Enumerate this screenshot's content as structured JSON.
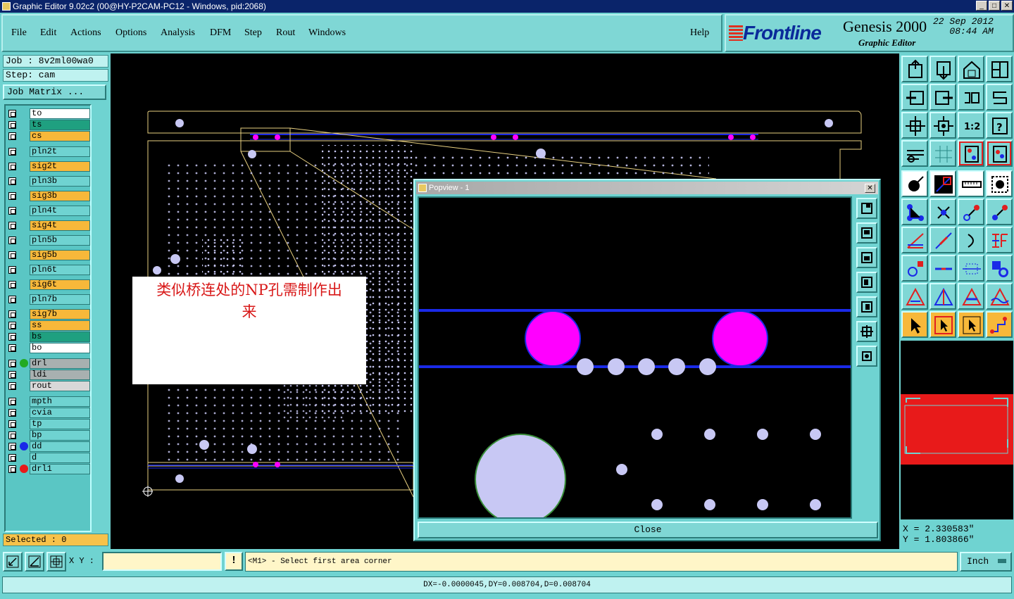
{
  "window": {
    "title": "Graphic Editor 9.02c2 (00@HY-P2CAM-PC12 - Windows, pid:2068)",
    "min": "_",
    "max": "□",
    "close": "✕"
  },
  "menu": [
    "File",
    "Edit",
    "Actions",
    "Options",
    "Analysis",
    "DFM",
    "Step",
    "Rout",
    "Windows"
  ],
  "help": "Help",
  "brand": {
    "logo": "Frontline",
    "product": "Genesis 2000",
    "subtitle": "Graphic Editor",
    "date": "22 Sep 2012",
    "time": "08:44 AM"
  },
  "job": {
    "job": "Job : 8v2ml00wa0",
    "step": "Step: cam",
    "matrix": "Job Matrix ..."
  },
  "layers": [
    {
      "name": "to",
      "color": "#ffffff",
      "dot": ""
    },
    {
      "name": "ts",
      "color": "#1fa080",
      "dot": ""
    },
    {
      "name": "cs",
      "color": "#f7b83a",
      "dot": ""
    },
    {
      "name": "pln2t",
      "color": "#6fd3d1",
      "dot": ""
    },
    {
      "name": "sig2t",
      "color": "#f7b83a",
      "dot": ""
    },
    {
      "name": "pln3b",
      "color": "#6fd3d1",
      "dot": ""
    },
    {
      "name": "sig3b",
      "color": "#f7b83a",
      "dot": ""
    },
    {
      "name": "pln4t",
      "color": "#6fd3d1",
      "dot": ""
    },
    {
      "name": "sig4t",
      "color": "#f7b83a",
      "dot": ""
    },
    {
      "name": "pln5b",
      "color": "#6fd3d1",
      "dot": ""
    },
    {
      "name": "sig5b",
      "color": "#f7b83a",
      "dot": ""
    },
    {
      "name": "pln6t",
      "color": "#6fd3d1",
      "dot": ""
    },
    {
      "name": "sig6t",
      "color": "#f7b83a",
      "dot": ""
    },
    {
      "name": "pln7b",
      "color": "#6fd3d1",
      "dot": ""
    },
    {
      "name": "sig7b",
      "color": "#f7b83a",
      "dot": ""
    },
    {
      "name": "ss",
      "color": "#f7b83a",
      "dot": ""
    },
    {
      "name": "bs",
      "color": "#1fa080",
      "dot": ""
    },
    {
      "name": "bo",
      "color": "#ffffff",
      "dot": ""
    },
    {
      "name": "drl",
      "color": "#a8b0b0",
      "dot": "#22aa22"
    },
    {
      "name": "ldi",
      "color": "#a8b0b0",
      "dot": ""
    },
    {
      "name": "rout",
      "color": "#d8d8d8",
      "dot": ""
    },
    {
      "name": "mpth",
      "color": "#6fd3d1",
      "dot": ""
    },
    {
      "name": "cvia",
      "color": "#6fd3d1",
      "dot": ""
    },
    {
      "name": "tp",
      "color": "#6fd3d1",
      "dot": ""
    },
    {
      "name": "bp",
      "color": "#6fd3d1",
      "dot": ""
    },
    {
      "name": "dd",
      "color": "#6fd3d1",
      "dot": "#1a2ae8"
    },
    {
      "name": "d",
      "color": "#6fd3d1",
      "dot": ""
    },
    {
      "name": "drl1",
      "color": "#6fd3d1",
      "dot": "#e81a1a"
    }
  ],
  "selected": "Selected : 0",
  "annotation": {
    "line1": "类似桥连处的NP孔需制作出",
    "line2": "来"
  },
  "popview": {
    "title": "Popview - 1",
    "close": "Close"
  },
  "coords": {
    "x": "X = 2.330583\"",
    "y": "Y = 1.803866\""
  },
  "bottom": {
    "xy_label": "X Y :",
    "xy_value": "",
    "bang": "!",
    "prompt": "<M1> - Select first area corner",
    "unit": "Inch"
  },
  "status": "DX=-0.0000045,DY=0.008704,D=0.008704",
  "colors": {
    "panel": "#6fd3d1",
    "magenta": "#ff00ff",
    "lavender": "#c8c8f4",
    "blue": "#1a2ae8",
    "outline": "#e8d080"
  }
}
